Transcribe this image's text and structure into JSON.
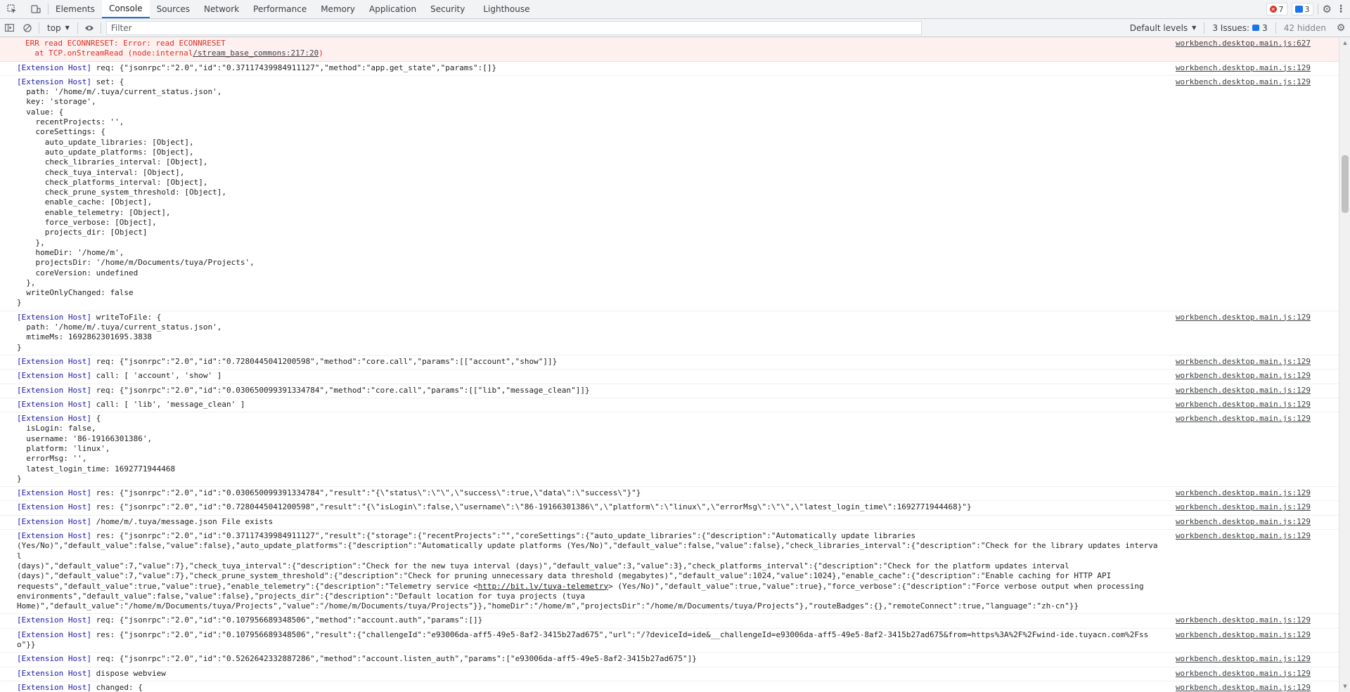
{
  "tabbar": {
    "tabs": [
      "Elements",
      "Console",
      "Sources",
      "Network",
      "Performance",
      "Memory",
      "Application",
      "Security",
      "Lighthouse"
    ],
    "active_tab": "Console",
    "errors_count": "7",
    "info_count": "3"
  },
  "toolbar": {
    "context": "top",
    "filter_placeholder": "Filter",
    "levels": "Default levels",
    "issues_label": "3 Issues:",
    "issues_count": "3",
    "hidden": "42 hidden"
  },
  "logs": [
    {
      "type": "err",
      "source": "workbench.desktop.main.js:627",
      "tag": "",
      "text": "ERR read ECONNRESET: Error: read ECONNRESET\n  at TCP.onStreamRead (node:internal/stream_base_commons:217:20)"
    },
    {
      "type": "log",
      "source": "workbench.desktop.main.js:129",
      "tag": "[Extension Host]",
      "text": " req: {\"jsonrpc\":\"2.0\",\"id\":\"0.37117439984911127\",\"method\":\"app.get_state\",\"params\":[]}"
    },
    {
      "type": "log",
      "source": "workbench.desktop.main.js:129",
      "tag": "[Extension Host]",
      "text": " set: {\n  path: '/home/m/.tuya/current_status.json',\n  key: 'storage',\n  value: {\n    recentProjects: '',\n    coreSettings: {\n      auto_update_libraries: [Object],\n      auto_update_platforms: [Object],\n      check_libraries_interval: [Object],\n      check_tuya_interval: [Object],\n      check_platforms_interval: [Object],\n      check_prune_system_threshold: [Object],\n      enable_cache: [Object],\n      enable_telemetry: [Object],\n      force_verbose: [Object],\n      projects_dir: [Object]\n    },\n    homeDir: '/home/m',\n    projectsDir: '/home/m/Documents/tuya/Projects',\n    coreVersion: undefined\n  },\n  writeOnlyChanged: false\n}"
    },
    {
      "type": "log",
      "source": "workbench.desktop.main.js:129",
      "tag": "[Extension Host]",
      "text": " writeToFile: {\n  path: '/home/m/.tuya/current_status.json',\n  mtimeMs: 1692862301695.3838\n}"
    },
    {
      "type": "log",
      "source": "workbench.desktop.main.js:129",
      "tag": "[Extension Host]",
      "text": " req: {\"jsonrpc\":\"2.0\",\"id\":\"0.7280445041200598\",\"method\":\"core.call\",\"params\":[[\"account\",\"show\"]]}"
    },
    {
      "type": "log",
      "source": "workbench.desktop.main.js:129",
      "tag": "[Extension Host]",
      "text": " call: [ 'account', 'show' ]"
    },
    {
      "type": "log",
      "source": "workbench.desktop.main.js:129",
      "tag": "[Extension Host]",
      "text": " req: {\"jsonrpc\":\"2.0\",\"id\":\"0.030650099391334784\",\"method\":\"core.call\",\"params\":[[\"lib\",\"message_clean\"]]}"
    },
    {
      "type": "log",
      "source": "workbench.desktop.main.js:129",
      "tag": "[Extension Host]",
      "text": " call: [ 'lib', 'message_clean' ]"
    },
    {
      "type": "log",
      "source": "workbench.desktop.main.js:129",
      "tag": "[Extension Host]",
      "text": " {\n  isLogin: false,\n  username: '86-19166301386',\n  platform: 'linux',\n  errorMsg: '',\n  latest_login_time: 1692771944468\n}"
    },
    {
      "type": "log",
      "source": "workbench.desktop.main.js:129",
      "tag": "[Extension Host]",
      "text": " res: {\"jsonrpc\":\"2.0\",\"id\":\"0.030650099391334784\",\"result\":\"{\\\"status\\\":\\\"\\\",\\\"success\\\":true,\\\"data\\\":\\\"success\\\"}\"}"
    },
    {
      "type": "log",
      "source": "workbench.desktop.main.js:129",
      "tag": "[Extension Host]",
      "text": " res: {\"jsonrpc\":\"2.0\",\"id\":\"0.7280445041200598\",\"result\":\"{\\\"isLogin\\\":false,\\\"username\\\":\\\"86-19166301386\\\",\\\"platform\\\":\\\"linux\\\",\\\"errorMsg\\\":\\\"\\\",\\\"latest_login_time\\\":1692771944468}\"}"
    },
    {
      "type": "log",
      "source": "workbench.desktop.main.js:129",
      "tag": "[Extension Host]",
      "text": " /home/m/.tuya/message.json File exists"
    },
    {
      "type": "log",
      "source": "workbench.desktop.main.js:129",
      "tag": "[Extension Host]",
      "text": " res: {\"jsonrpc\":\"2.0\",\"id\":\"0.37117439984911127\",\"result\":{\"storage\":{\"recentProjects\":\"\",\"coreSettings\":{\"auto_update_libraries\":{\"description\":\"Automatically update libraries\n(Yes/No)\",\"default_value\":false,\"value\":false},\"auto_update_platforms\":{\"description\":\"Automatically update platforms (Yes/No)\",\"default_value\":false,\"value\":false},\"check_libraries_interval\":{\"description\":\"Check for the library updates interval\n(days)\",\"default_value\":7,\"value\":7},\"check_tuya_interval\":{\"description\":\"Check for the new tuya interval (days)\",\"default_value\":3,\"value\":3},\"check_platforms_interval\":{\"description\":\"Check for the platform updates interval\n(days)\",\"default_value\":7,\"value\":7},\"check_prune_system_threshold\":{\"description\":\"Check for pruning unnecessary data threshold (megabytes)\",\"default_value\":1024,\"value\":1024},\"enable_cache\":{\"description\":\"Enable caching for HTTP API\nrequests\",\"default_value\":true,\"value\":true},\"enable_telemetry\":{\"description\":\"Telemetry service <http://bit.ly/tuya-telemetry> (Yes/No)\",\"default_value\":true,\"value\":true},\"force_verbose\":{\"description\":\"Force verbose output when processing\nenvironments\",\"default_value\":false,\"value\":false},\"projects_dir\":{\"description\":\"Default location for tuya projects (tuya\nHome)\",\"default_value\":\"/home/m/Documents/tuya/Projects\",\"value\":\"/home/m/Documents/tuya/Projects\"}},\"homeDir\":\"/home/m\",\"projectsDir\":\"/home/m/Documents/tuya/Projects\"},\"routeBadges\":{},\"remoteConnect\":true,\"language\":\"zh-cn\"}}"
    },
    {
      "type": "log",
      "source": "workbench.desktop.main.js:129",
      "tag": "[Extension Host]",
      "text": " req: {\"jsonrpc\":\"2.0\",\"id\":\"0.107956689348506\",\"method\":\"account.auth\",\"params\":[]}"
    },
    {
      "type": "log",
      "source": "workbench.desktop.main.js:129",
      "tag": "[Extension Host]",
      "text": " res: {\"jsonrpc\":\"2.0\",\"id\":\"0.107956689348506\",\"result\":{\"challengeId\":\"e93006da-aff5-49e5-8af2-3415b27ad675\",\"url\":\"/?deviceId=ide&__challengeId=e93006da-aff5-49e5-8af2-3415b27ad675&from=https%3A%2F%2Fwind-ide.tuyacn.com%2Fsso\"}}"
    },
    {
      "type": "log",
      "source": "workbench.desktop.main.js:129",
      "tag": "[Extension Host]",
      "text": " req: {\"jsonrpc\":\"2.0\",\"id\":\"0.5262642332887286\",\"method\":\"account.listen_auth\",\"params\":[\"e93006da-aff5-49e5-8af2-3415b27ad675\"]}"
    },
    {
      "type": "log",
      "source": "workbench.desktop.main.js:129",
      "tag": "[Extension Host]",
      "text": " dispose webview"
    },
    {
      "type": "log",
      "source": "workbench.desktop.main.js:129",
      "tag": "[Extension Host]",
      "text": " changed: {\n  path: '/home/m/.tuya/current_status.json',"
    }
  ]
}
